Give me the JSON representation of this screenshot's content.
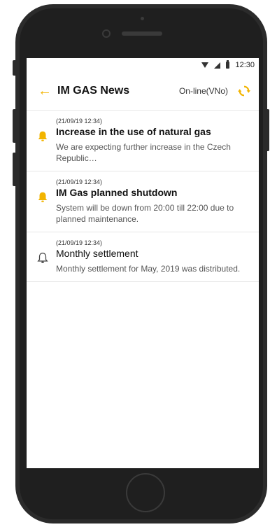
{
  "statusbar": {
    "time": "12:30",
    "icons": [
      "wifi-icon",
      "signal-icon",
      "battery-icon"
    ]
  },
  "appbar": {
    "back_icon": "arrow-left-icon",
    "title": "IM GAS News",
    "connection_status": "On-line(VNo)",
    "refresh_icon": "refresh-icon"
  },
  "colors": {
    "accent": "#f2b400",
    "text": "#111111",
    "muted": "#555555"
  },
  "news": [
    {
      "time": "(21/09/19 12:34)",
      "title": "Increase in the use of natural gas",
      "text": "We are expecting further increase in the Czech Republic…",
      "unread": true
    },
    {
      "time": "(21/09/19 12:34)",
      "title": "IM Gas planned shutdown",
      "text": "System will be down from 20:00 till 22:00 due to planned maintenance.",
      "unread": true
    },
    {
      "time": "(21/09/19 12:34)",
      "title": "Monthly settlement",
      "text": "Monthly settlement for May, 2019 was distributed.",
      "unread": false
    }
  ]
}
